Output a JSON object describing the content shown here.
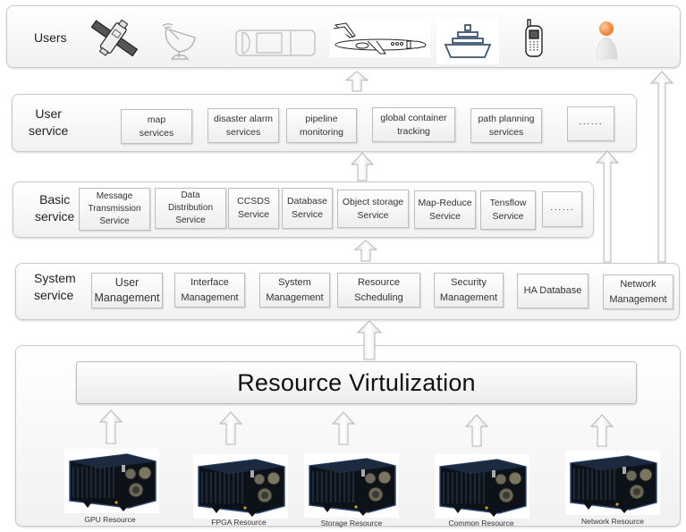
{
  "layers": {
    "users": {
      "label": "Users",
      "icons": [
        "satellite-icon",
        "satellite-dish-icon",
        "car-icon",
        "airplane-icon",
        "ship-icon",
        "mobile-phone-icon",
        "person-icon"
      ]
    },
    "user_service": {
      "label": "User\nservice",
      "items": [
        {
          "label": "map\nservices"
        },
        {
          "label": "disaster alarm\nservices"
        },
        {
          "label": "pipeline\nmonitoring"
        },
        {
          "label": "global container\ntracking"
        },
        {
          "label": "path planning\nservices"
        },
        {
          "label": "······"
        }
      ]
    },
    "basic_service": {
      "label": "Basic\nservice",
      "items": [
        {
          "label": "Message\nTransmission\nService"
        },
        {
          "label": "Data\nDistribution\nService"
        },
        {
          "label": "CCSDS\nService"
        },
        {
          "label": "Database\nService"
        },
        {
          "label": "Object storage\nService"
        },
        {
          "label": "Map-Reduce\nService"
        },
        {
          "label": "Tensflow\nService"
        },
        {
          "label": "······"
        }
      ]
    },
    "system_service": {
      "label": "System\nservice",
      "items": [
        {
          "label": "User\nManagement"
        },
        {
          "label": "Interface\nManagement"
        },
        {
          "label": "System\nManagement"
        },
        {
          "label": "Resource\nScheduling"
        },
        {
          "label": "Security\nManagement"
        },
        {
          "label": "HA Database"
        },
        {
          "label": "Network\nManagement"
        }
      ]
    },
    "resource": {
      "virtualization_label": "Resource Virtulization",
      "devices": [
        {
          "label": "GPU Resource"
        },
        {
          "label": "FPGA Resource"
        },
        {
          "label": "Storage Resource"
        },
        {
          "label": "Common Resource"
        },
        {
          "label": "Network Resource"
        }
      ]
    }
  }
}
